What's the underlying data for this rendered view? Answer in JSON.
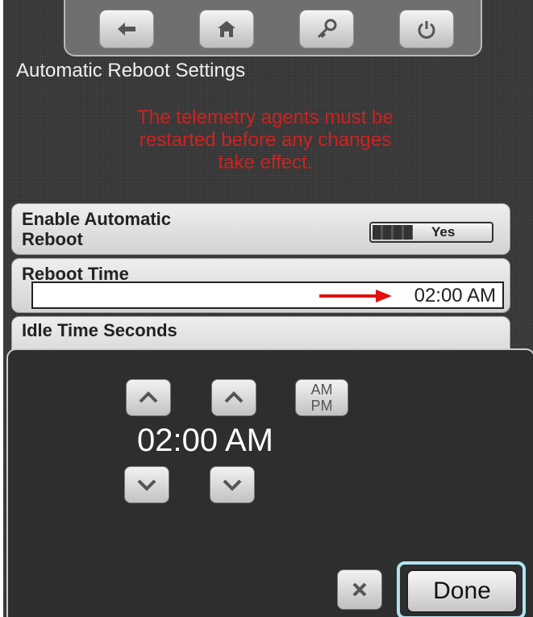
{
  "toolbar": {
    "buttons": [
      {
        "icon": "back-arrow-icon"
      },
      {
        "icon": "home-icon"
      },
      {
        "icon": "key-icon"
      },
      {
        "icon": "power-icon"
      }
    ]
  },
  "page": {
    "title": "Automatic Reboot Settings",
    "warning": "The telemetry agents must be\nrestarted before any changes\ntake effect."
  },
  "settings": {
    "enable": {
      "label": "Enable Automatic\nReboot",
      "value": "Yes"
    },
    "reboot_time": {
      "label": "Reboot Time",
      "value": "02:00 AM"
    },
    "idle": {
      "label": "Idle Time Seconds"
    }
  },
  "picker": {
    "time": "02:00 AM",
    "am_label": "AM",
    "pm_label": "PM",
    "done_label": "Done"
  },
  "colors": {
    "warning": "#cc2222",
    "arrow": "#e01010",
    "done_highlight": "#aee3f2"
  }
}
